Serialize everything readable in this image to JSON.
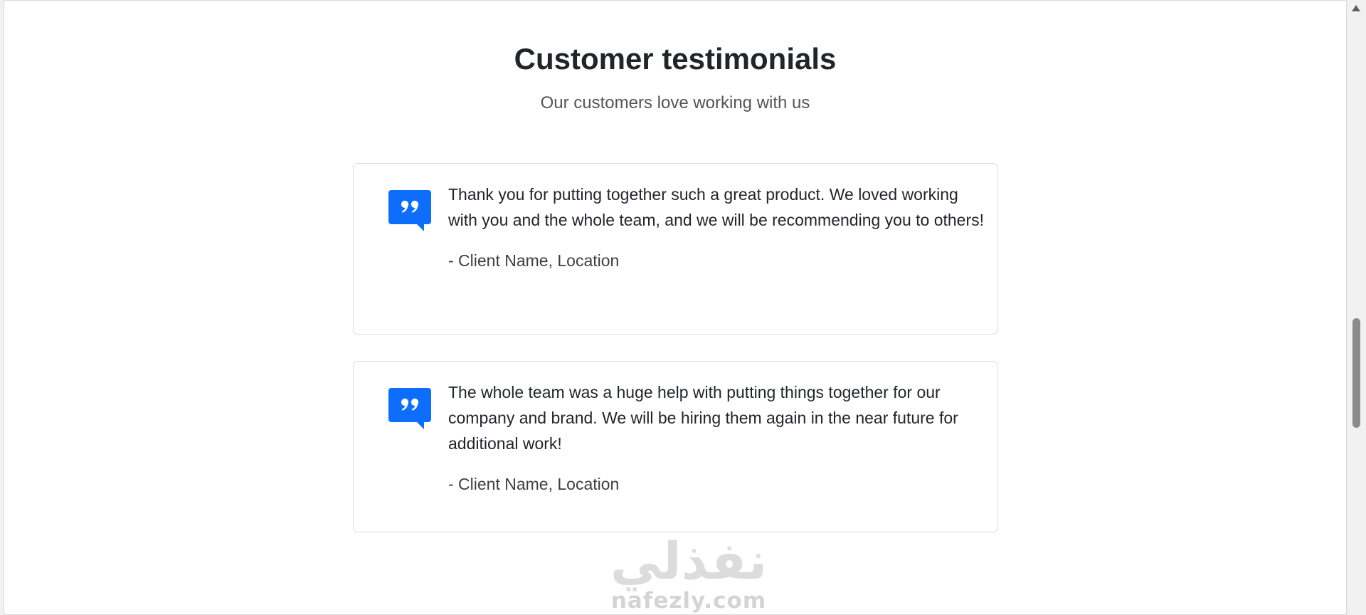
{
  "page": {
    "title": "Customer testimonials",
    "subtitle": "Our customers love working with us"
  },
  "testimonials": [
    {
      "text": "Thank you for putting together such a great product. We loved working with you and the whole team, and we will be recommending you to others!",
      "author": "- Client Name, Location",
      "icon": "quote-icon"
    },
    {
      "text": "The whole team was a huge help with putting things together for our company and brand. We will be hiring them again in the near future for additional work!",
      "author": "- Client Name, Location",
      "icon": "quote-icon"
    }
  ],
  "watermark": {
    "arabic": "نفذلي",
    "domain": "nafezly.com"
  },
  "colors": {
    "accent": "#0d6efd",
    "text": "#212529",
    "border": "#d9dde1"
  }
}
